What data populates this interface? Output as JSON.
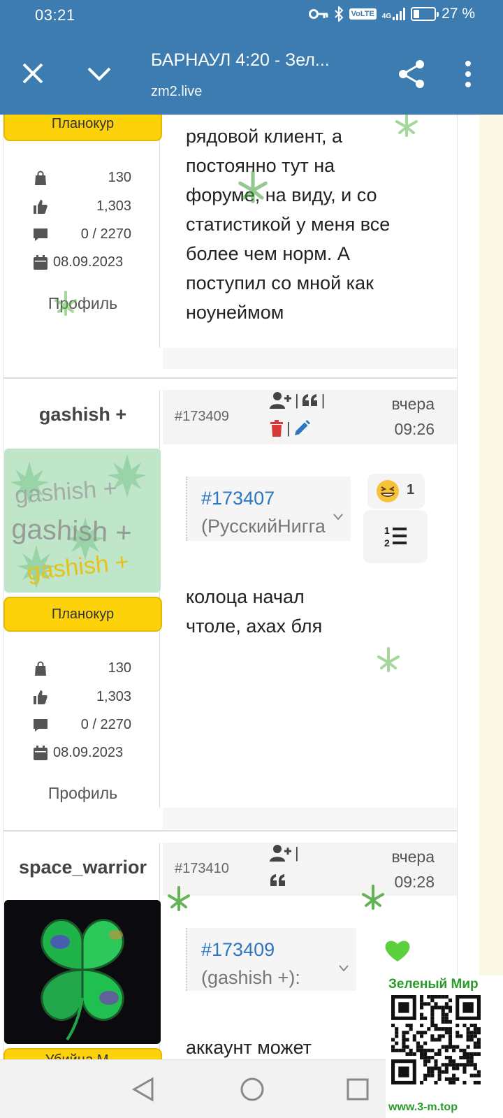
{
  "status_bar": {
    "time": "03:21",
    "volte": "VoLTE",
    "network": "4G",
    "battery_level": 0.27,
    "battery_text": "27 %"
  },
  "toolbar": {
    "title": "БАРНАУЛ 4:20 - Зел...",
    "url": "zm2.live"
  },
  "post_prev": {
    "rank": "Планокур",
    "stats": {
      "orders": "130",
      "likes": "1,303",
      "messages": "0 / 2270",
      "joined": "08.09.2023"
    },
    "profile_link": "Профиль",
    "text_lines": [
      "рядовой клиент, а",
      "постоянно тут на",
      "форуме, на виду, и со",
      "статистикой у меня все",
      "более чем норм. А",
      "поступил со мной как",
      "ноунеймом"
    ]
  },
  "post_gashish": {
    "username": "gashish +",
    "post_id": "#173409",
    "time_line1": "вчера",
    "time_line2": "09:26",
    "avatar_text": [
      "gashish +",
      "gashish +",
      "gashish +"
    ],
    "quote_ref": "#173407",
    "quote_author": "(РусскийНигга",
    "reaction_count": "1",
    "rank": "Планокур",
    "stats": {
      "orders": "130",
      "likes": "1,303",
      "messages": "0 / 2270",
      "joined": "08.09.2023"
    },
    "profile_link": "Профиль",
    "text_lines": [
      "колоца начал",
      "чтоле, ахах бля"
    ]
  },
  "post_space": {
    "username": "space_warrior",
    "post_id": "#173410",
    "time_line1": "вчера",
    "time_line2": "09:28",
    "quote_ref": "#173409",
    "quote_author": "(gashish +):",
    "rank_partial": "Убийца М...",
    "text_lines": [
      "аккаунт может"
    ]
  },
  "qr": {
    "brand": "Зеленый Мир",
    "url": "www.3-m.top"
  },
  "colors": {
    "toolbar": "#3d7cb0",
    "rank_badge": "#fdd20a",
    "link": "#2d77c2",
    "leaf": "#6fbf4b"
  }
}
